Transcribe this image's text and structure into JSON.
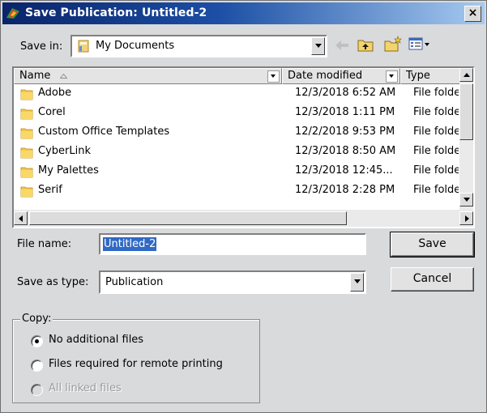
{
  "dialog": {
    "title": "Save Publication: Untitled-2",
    "close_glyph": "×"
  },
  "save_in": {
    "label": "Save in:",
    "value": "My Documents"
  },
  "toolbar": {
    "icons": [
      "back-arrow-icon",
      "up-one-level-icon",
      "new-folder-icon",
      "view-menu-icon"
    ]
  },
  "file_list": {
    "columns": [
      "Name",
      "Date modified",
      "Type"
    ],
    "rows": [
      {
        "name": "Adobe",
        "date": "12/3/2018 6:52 AM",
        "type": "File folde"
      },
      {
        "name": "Corel",
        "date": "12/3/2018 1:11 PM",
        "type": "File folde"
      },
      {
        "name": "Custom Office Templates",
        "date": "12/2/2018 9:53 PM",
        "type": "File folde"
      },
      {
        "name": "CyberLink",
        "date": "12/3/2018 8:50 AM",
        "type": "File folde"
      },
      {
        "name": "My Palettes",
        "date": "12/3/2018 12:45...",
        "type": "File folde"
      },
      {
        "name": "Serif",
        "date": "12/3/2018 2:28 PM",
        "type": "File folde"
      }
    ]
  },
  "file_name": {
    "label": "File name:",
    "value": "Untitled-2"
  },
  "save_as_type": {
    "label": "Save as type:",
    "value": "Publication"
  },
  "buttons": {
    "save": "Save",
    "cancel": "Cancel"
  },
  "copy_group": {
    "title": "Copy:",
    "options": [
      {
        "label": "No additional files",
        "checked": true,
        "enabled": true
      },
      {
        "label": "Files required for remote printing",
        "checked": false,
        "enabled": true
      },
      {
        "label": "All linked files",
        "checked": false,
        "enabled": false
      }
    ]
  },
  "colors": {
    "title_bar_start": "#0a246a",
    "title_bar_end": "#a6caf0",
    "dialog_bg": "#d9dadc",
    "selection": "#316ac5"
  }
}
